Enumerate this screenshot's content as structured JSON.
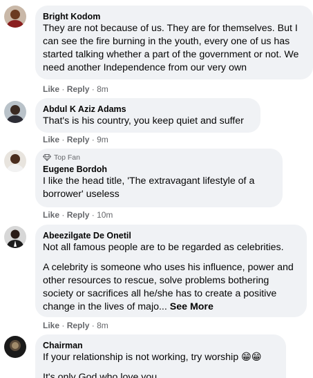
{
  "comments": [
    {
      "author": "Bright Kodom",
      "text": "They are not because of us. They are for themselves. But I can see the fire burning in the youth, every one of us has started talking whether a part of the government or not. We need another Independence from our very own",
      "like": "Like",
      "reply": "Reply",
      "sep": "·",
      "time": "8m"
    },
    {
      "author": "Abdul K Aziz Adams",
      "text": "That's is his country, you keep quiet and suffer",
      "like": "Like",
      "reply": "Reply",
      "sep": "·",
      "time": "9m"
    },
    {
      "badge": "Top Fan",
      "author": "Eugene Bordoh",
      "text": "I like the head title, 'The extravagant lifestyle of a borrower' useless",
      "like": "Like",
      "reply": "Reply",
      "sep": "·",
      "time": "10m"
    },
    {
      "author": "Abeezilgate De Onetil",
      "text": "Not all famous people are to be regarded as celebrities.",
      "text2": "A celebrity is someone who uses his influence, power and other resources to rescue, solve problems bothering society or sacrifices all he/she has to create a positive change in the lives of majo...",
      "see_more": "See More",
      "like": "Like",
      "reply": "Reply",
      "sep": "·",
      "time": "8m"
    },
    {
      "author": "Chairman",
      "text": "If your relationship is not working, try worship 😁😁",
      "text2": "It's only God who love you"
    }
  ],
  "colors": {
    "bubble": "#f0f2f5",
    "meta": "#65676b",
    "text": "#050505"
  }
}
